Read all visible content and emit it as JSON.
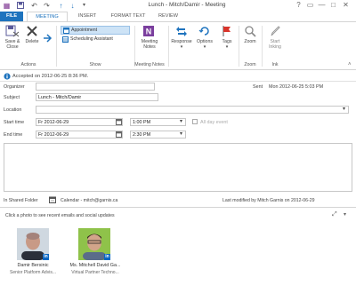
{
  "window": {
    "title": "Lunch - Mitch/Damir - Meeting",
    "help": "?",
    "restore_ribbon": "▭",
    "minimize": "—",
    "maximize": "□",
    "close": "✕"
  },
  "tabs": [
    {
      "label": "FILE"
    },
    {
      "label": "MEETING"
    },
    {
      "label": "INSERT"
    },
    {
      "label": "FORMAT TEXT"
    },
    {
      "label": "REVIEW"
    }
  ],
  "ribbon": {
    "save_close": "Save &",
    "save_close2": "Close",
    "delete": "Delete",
    "actions_group": "Actions",
    "appointment": "Appointment",
    "scheduling": "Scheduling Assistant",
    "show_group": "Show",
    "meeting_notes": "Meeting",
    "meeting_notes2": "Notes",
    "meeting_notes_group": "Meeting Notes",
    "response": "Response",
    "options": "Options",
    "tags": "Tags",
    "zoom": "Zoom",
    "zoom_group": "Zoom",
    "start_inking": "Start",
    "start_inking2": "Inking",
    "ink_group": "Ink"
  },
  "form": {
    "info": "Accepted on 2012-06-25 8:36 PM.",
    "organizer_label": "Organizer",
    "sent_label": "Sent",
    "sent_value": "Mon 2012-06-25 5:03 PM",
    "subject_label": "Subject",
    "subject_value": "Lunch - Mitch/Damir",
    "location_label": "Location",
    "location_value": "",
    "start_label": "Start time",
    "start_date": "Fr 2012-06-29",
    "start_time": "1:00 PM",
    "allday_label": "All day event",
    "end_label": "End time",
    "end_date": "Fr 2012-06-29",
    "end_time": "2:30 PM"
  },
  "footer": {
    "folder_label": "In Shared Folder",
    "calendar": "Calendar - mitch@garnis.ca",
    "modified": "Last modified by Mitch Garnis on 2012-06-29"
  },
  "people": {
    "prompt": "Click a photo to see recent emails and social updates",
    "list": [
      {
        "name": "Damir Bersinic",
        "title": "Senior Platform Advis..."
      },
      {
        "name": "Ms. Mitchell David Ga...",
        "title": "Virtual Partner Techno..."
      }
    ]
  }
}
